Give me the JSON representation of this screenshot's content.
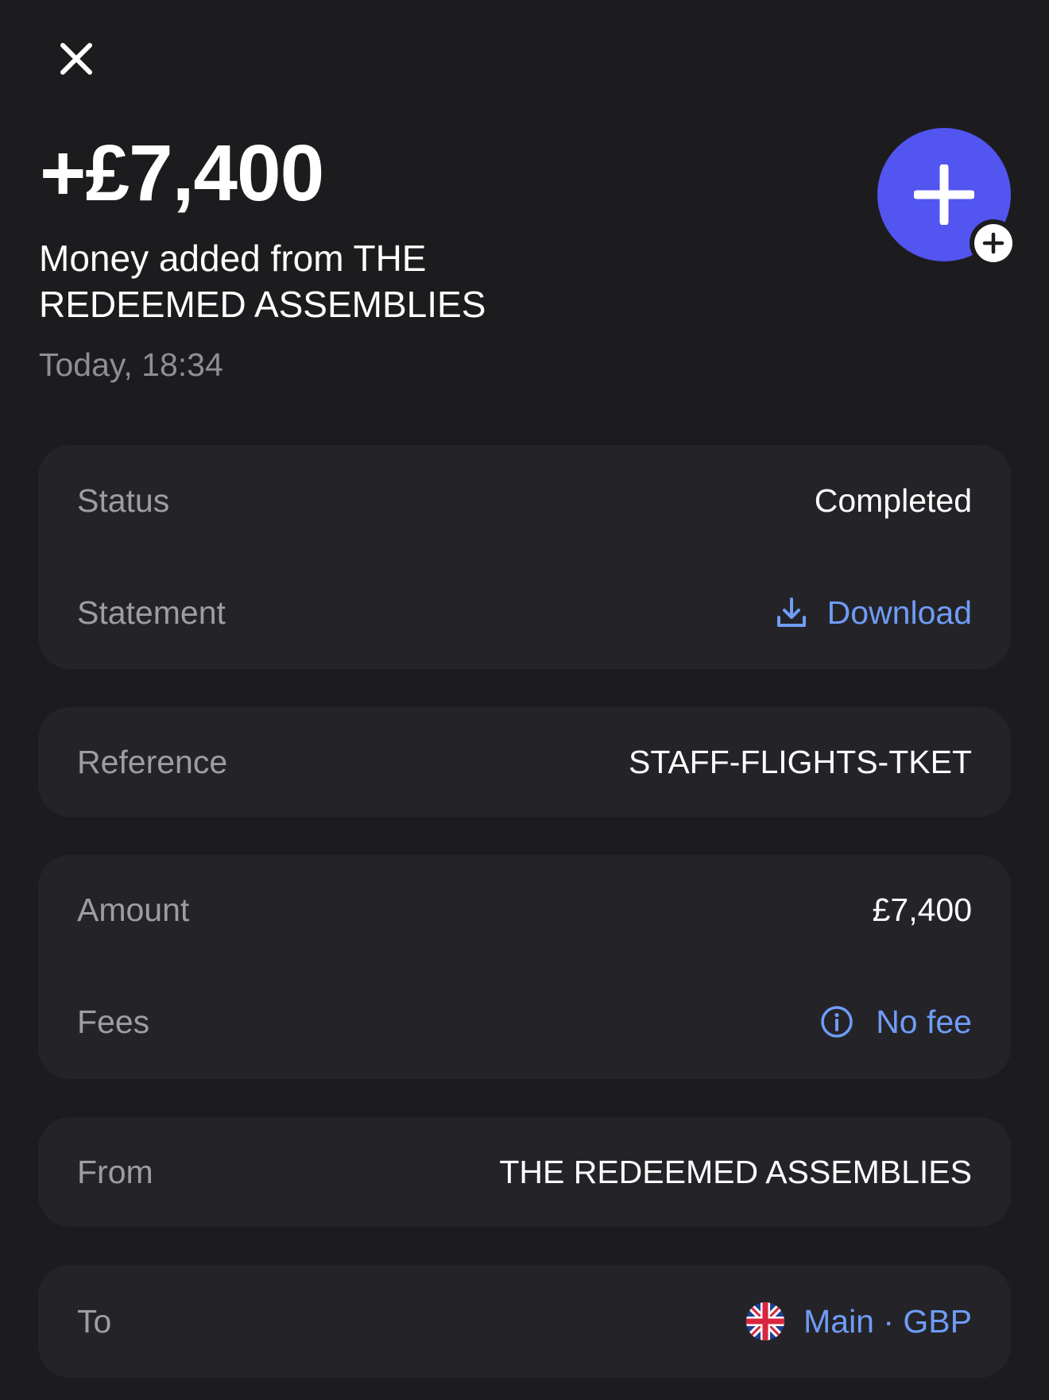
{
  "header": {
    "close_icon": "close-icon",
    "amount": "+£7,400",
    "description": "Money added from THE REDEEMED ASSEMBLIES",
    "timestamp": "Today, 18:34",
    "avatar_icon": "plus-icon",
    "avatar_color": "#5255f0",
    "badge_icon": "plus-circle-icon"
  },
  "status_card": {
    "status_label": "Status",
    "status_value": "Completed",
    "statement_label": "Statement",
    "statement_action": "Download",
    "statement_icon": "download-icon"
  },
  "reference_card": {
    "label": "Reference",
    "value": "STAFF-FLIGHTS-TKET"
  },
  "amount_card": {
    "amount_label": "Amount",
    "amount_value": "£7,400",
    "fees_label": "Fees",
    "fees_value": "No fee",
    "fees_icon": "info-icon"
  },
  "from_card": {
    "label": "From",
    "value": "THE REDEEMED ASSEMBLIES"
  },
  "to_card": {
    "label": "To",
    "value": "Main · GBP",
    "flag_icon": "uk-flag-icon"
  },
  "colors": {
    "background": "#1c1c1f",
    "card": "#242428",
    "link": "#6f9cf7",
    "muted": "#9d9da3"
  }
}
